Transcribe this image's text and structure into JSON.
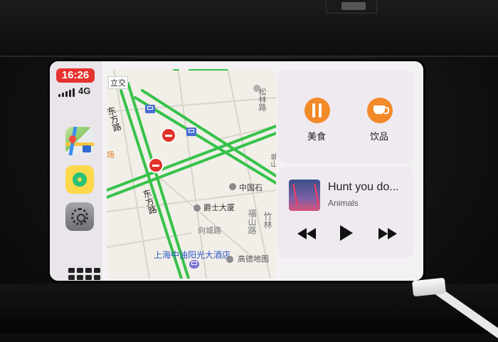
{
  "status": {
    "time": "16:26",
    "network": "4G"
  },
  "sidebar": {
    "apps": [
      {
        "name": "maps",
        "icon": "maps-app-icon"
      },
      {
        "name": "music",
        "icon": "music-app-icon"
      },
      {
        "name": "settings",
        "icon": "settings-app-icon"
      }
    ],
    "home_icon": "app-grid-icon"
  },
  "map": {
    "labels": {
      "lijiao": "立交",
      "dongfang_road_1": "东方路",
      "dongfang_road_2": "东方路",
      "chang": "场",
      "songlin_road": "松林路",
      "zhongguo": "中国石",
      "jueshi": "爵士大厦",
      "xiangcheng_road": "向城路",
      "fushan_road": "福山路",
      "zhulin_road": "竹林",
      "hotel": "上海中油阳光大酒店",
      "gaode": "高德地图",
      "chengshan": "城山"
    }
  },
  "food": {
    "items": [
      {
        "label": "美食",
        "icon": "fork-knife-icon"
      },
      {
        "label": "饮品",
        "icon": "coffee-cup-icon"
      }
    ]
  },
  "now_playing": {
    "song": "Hunt you do...",
    "artist": "Animals"
  },
  "colors": {
    "time_badge": "#e5322f",
    "food_button": "#f28a2a",
    "road_green": "#36c24a",
    "map_bg": "#f2efe8"
  }
}
